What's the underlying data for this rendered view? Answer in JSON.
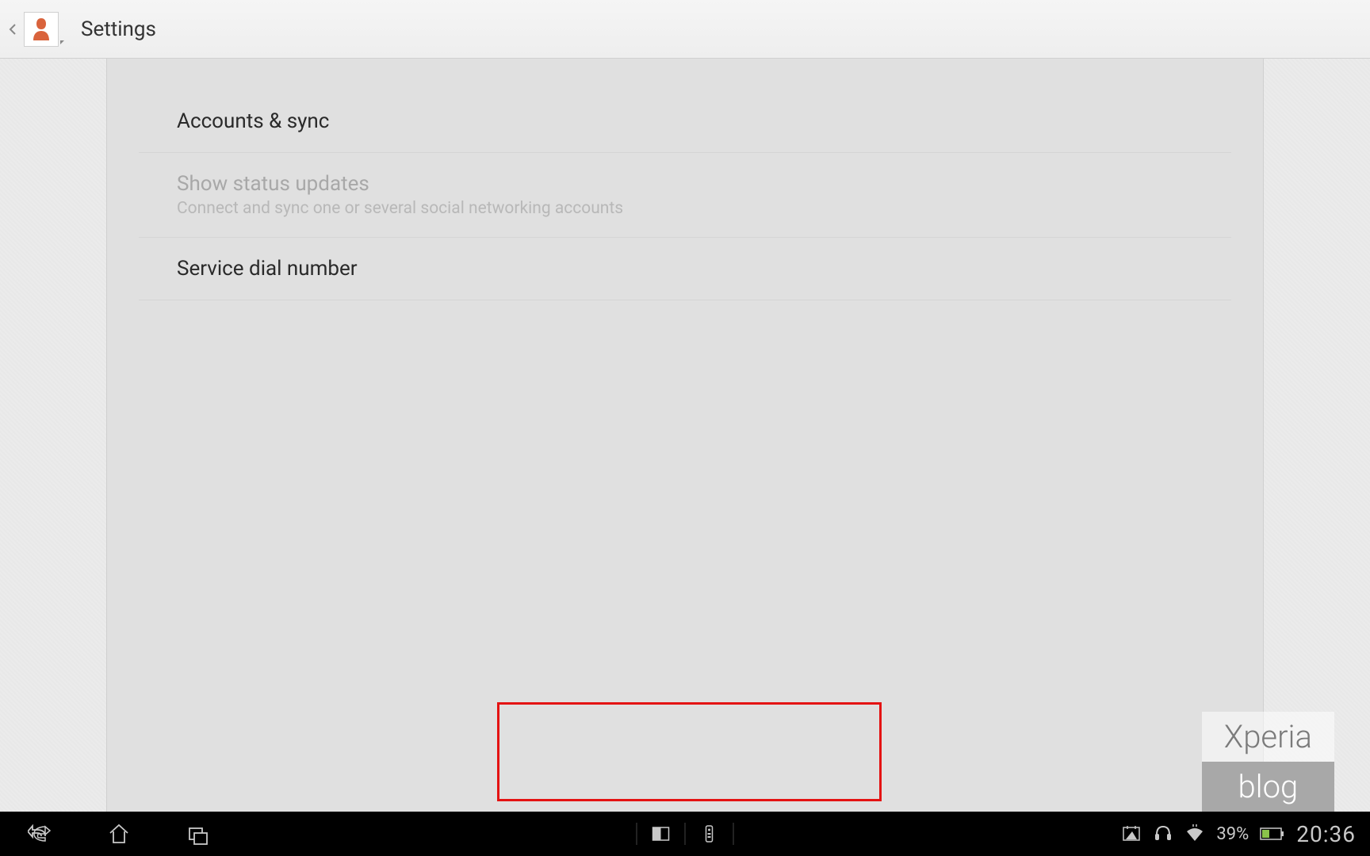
{
  "actionbar": {
    "title": "Settings",
    "app_icon_name": "contacts-icon"
  },
  "settings": {
    "items": [
      {
        "title": "Accounts & sync",
        "subtitle": null,
        "enabled": true
      },
      {
        "title": "Show status updates",
        "subtitle": "Connect and sync one or several social networking accounts",
        "enabled": false
      },
      {
        "title": "Service dial number",
        "subtitle": null,
        "enabled": true
      }
    ]
  },
  "watermark": {
    "line1": "Xperia",
    "line2": "blog"
  },
  "statusbar": {
    "battery_percent": "39%",
    "time": "20:36"
  }
}
